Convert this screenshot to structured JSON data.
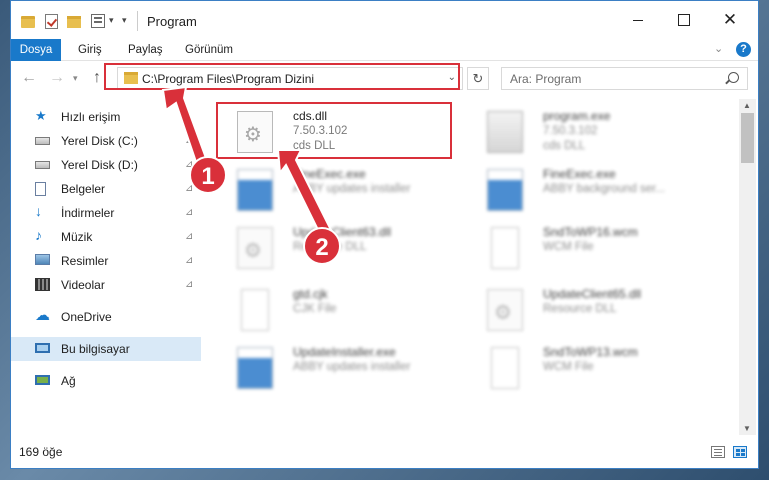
{
  "window": {
    "title": "Program",
    "close_glyph": "✕"
  },
  "ribbon": {
    "tabs": [
      "Dosya",
      "Giriş",
      "Paylaş",
      "Görünüm"
    ],
    "help_glyph": "?",
    "collapse_glyph": "⌄"
  },
  "navigation": {
    "back_glyph": "←",
    "forward_glyph": "→",
    "up_glyph": "↑",
    "address": "C:\\Program Files\\Program Dizini",
    "address_dropdown_glyph": "⌄",
    "refresh_glyph": "↻",
    "search_placeholder": "Ara: Program"
  },
  "sidebar": {
    "items": [
      {
        "label": "Hızlı erişim",
        "icon": "star-icon",
        "pinned": false
      },
      {
        "label": "Yerel Disk (C:)",
        "icon": "drive-icon",
        "pinned": true
      },
      {
        "label": "Yerel Disk (D:)",
        "icon": "drive-icon",
        "pinned": true
      },
      {
        "label": "Belgeler",
        "icon": "documents-icon",
        "pinned": true
      },
      {
        "label": "İndirmeler",
        "icon": "downloads-icon",
        "pinned": true
      },
      {
        "label": "Müzik",
        "icon": "music-icon",
        "pinned": true
      },
      {
        "label": "Resimler",
        "icon": "pictures-icon",
        "pinned": true
      },
      {
        "label": "Videolar",
        "icon": "videos-icon",
        "pinned": true
      },
      {
        "label": "OneDrive",
        "icon": "cloud-icon",
        "pinned": false
      },
      {
        "label": "Bu bilgisayar",
        "icon": "computer-icon",
        "pinned": false,
        "selected": true
      },
      {
        "label": "Ağ",
        "icon": "network-icon",
        "pinned": false
      }
    ],
    "pin_glyph": "📌"
  },
  "files": [
    {
      "name": "cds.dll",
      "line1": "7.50.3.102",
      "line2": "cds DLL",
      "kind": "dll",
      "highlighted": true
    },
    {
      "name": "program.exe",
      "line1": "7.50.3.102",
      "line2": "cds DLL",
      "kind": "exe"
    },
    {
      "name": "FineExec.exe",
      "line1": "ABBY updates installer",
      "line2": "",
      "kind": "exe"
    },
    {
      "name": "FineExec.exe",
      "line1": "ABBY background ser...",
      "line2": "",
      "kind": "exe"
    },
    {
      "name": "UpdateClient63.dll",
      "line1": "Resource DLL",
      "line2": "",
      "kind": "dll"
    },
    {
      "name": "SndToWP16.wcm",
      "line1": "WCM File",
      "line2": "",
      "kind": "page"
    },
    {
      "name": "gtd.cjk",
      "line1": "CJK File",
      "line2": "",
      "kind": "page"
    },
    {
      "name": "UpdateClient65.dll",
      "line1": "Resource DLL",
      "line2": "",
      "kind": "dll"
    },
    {
      "name": "UpdateInstaller.exe",
      "line1": "ABBY updates installer",
      "line2": "",
      "kind": "exe"
    },
    {
      "name": "SndToWP13.wcm",
      "line1": "WCM File",
      "line2": "",
      "kind": "page"
    }
  ],
  "status": {
    "item_count": "169 öğe"
  },
  "annotations": {
    "callout_1": "1",
    "callout_2": "2",
    "color": "#d9303a"
  }
}
